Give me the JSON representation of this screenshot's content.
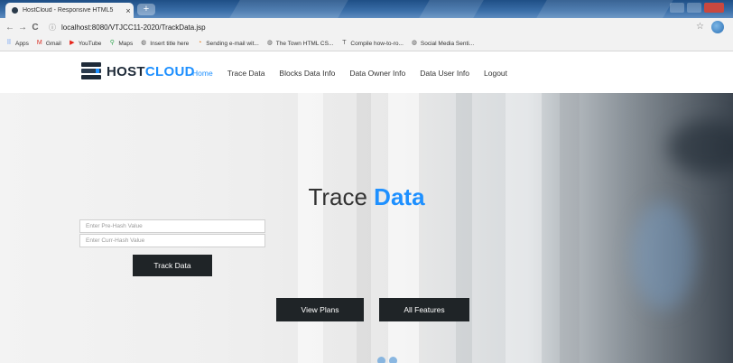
{
  "browser": {
    "tab_title": "HostCloud - Responsive HTML5",
    "tab_close": "×",
    "new_tab": "+",
    "nav_back": "←",
    "nav_forward": "→",
    "nav_reload": "C",
    "url": "localhost:8080/VTJCC11-2020/TrackData.jsp",
    "star": "☆"
  },
  "bookmarks": [
    {
      "label": "Apps",
      "icon": "apps-grid-icon",
      "glyph": "⠿",
      "color": "#4285f4"
    },
    {
      "label": "Gmail",
      "icon": "gmail-icon",
      "glyph": "M",
      "color": "#d93025"
    },
    {
      "label": "YouTube",
      "icon": "youtube-icon",
      "glyph": "▶",
      "color": "#e62117"
    },
    {
      "label": "Maps",
      "icon": "maps-pin-icon",
      "glyph": "⚲",
      "color": "#34a853"
    },
    {
      "label": "Insert title here",
      "icon": "globe-icon",
      "glyph": "◍",
      "color": "#555"
    },
    {
      "label": "Sending e-mail wit...",
      "icon": "sending-mail-icon",
      "glyph": "◔",
      "color": "#e8710a"
    },
    {
      "label": "The Town HTML CS...",
      "icon": "globe-icon",
      "glyph": "◍",
      "color": "#555"
    },
    {
      "label": "Compile how-to-ro...",
      "icon": "compile-icon",
      "glyph": "T",
      "color": "#555"
    },
    {
      "label": "Social Media Senti...",
      "icon": "globe-icon",
      "glyph": "◍",
      "color": "#555"
    }
  ],
  "site": {
    "logo_host": "HOST",
    "logo_cloud": "CLOUD",
    "menu": [
      {
        "label": "Home",
        "active": true
      },
      {
        "label": "Trace Data",
        "active": false
      },
      {
        "label": "Blocks Data Info",
        "active": false
      },
      {
        "label": "Data Owner Info",
        "active": false
      },
      {
        "label": "Data User Info",
        "active": false
      },
      {
        "label": "Logout",
        "active": false
      }
    ],
    "accent_color": "#1e90ff",
    "dark_color": "#1f2427"
  },
  "hero": {
    "title_plain": "Trace ",
    "title_highlight": "Data"
  },
  "form": {
    "prehash_placeholder": "Enter Pre-Hash Value",
    "currhash_placeholder": "Enter Curr-Hash Value",
    "prehash_value": "",
    "currhash_value": "",
    "submit_label": "Track Data"
  },
  "cta": {
    "view_plans": "View Plans",
    "all_features": "All Features"
  }
}
